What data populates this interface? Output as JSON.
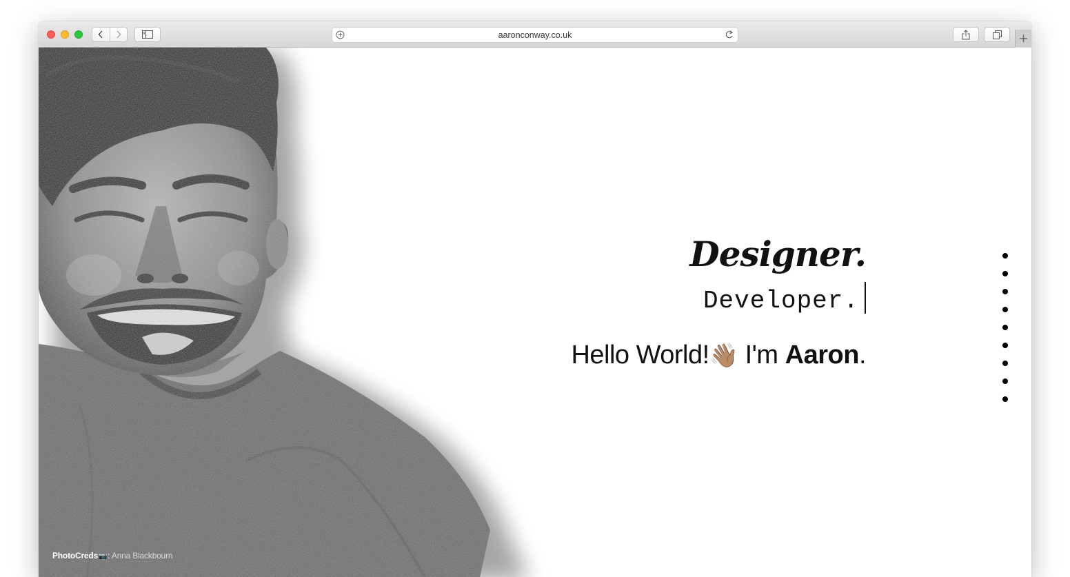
{
  "browser": {
    "url": "aaronconway.co.uk",
    "new_tab_label": "+"
  },
  "photo": {
    "alt": "Black and white photo of a smiling man",
    "credit_label": "PhotoCreds",
    "credit_icon": "📷",
    "credit_separator": ":",
    "credit_name": "Anna Blackbourn"
  },
  "hero": {
    "title": "Designer.",
    "subtitle": "Developer.",
    "greeting_prefix": "Hello World!",
    "wave_emoji": "👋🏽",
    "greeting_im": " I'm ",
    "name": "Aaron",
    "name_suffix": "."
  },
  "page_nav": {
    "dot_count": 9
  }
}
